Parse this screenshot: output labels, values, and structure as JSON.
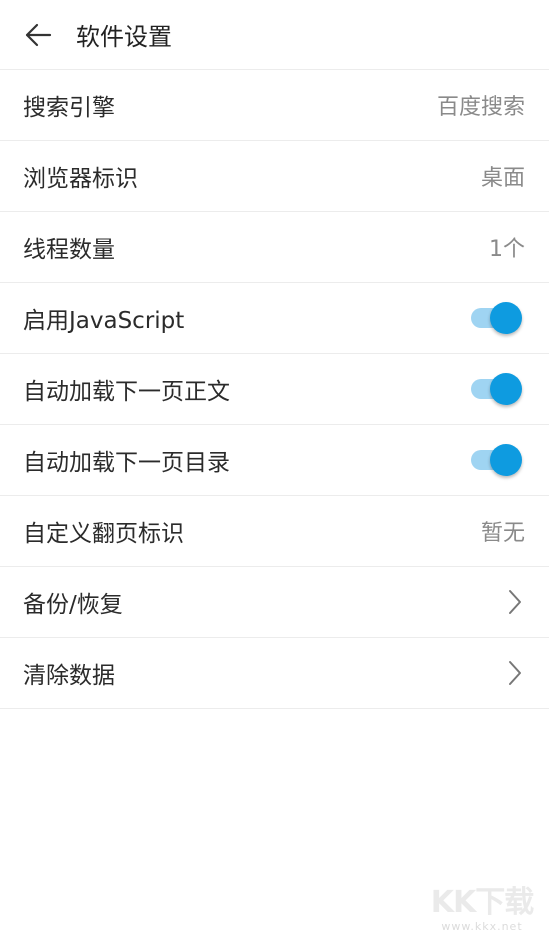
{
  "header": {
    "title": "软件设置"
  },
  "settings": [
    {
      "label": "搜索引擎",
      "value": "百度搜索"
    },
    {
      "label": "浏览器标识",
      "value": "桌面"
    },
    {
      "label": "线程数量",
      "value": "1个"
    },
    {
      "label": "启用JavaScript",
      "toggle": true
    },
    {
      "label": "自动加载下一页正文",
      "toggle": true
    },
    {
      "label": "自动加载下一页目录",
      "toggle": true
    },
    {
      "label": "自定义翻页标识",
      "value": "暂无"
    },
    {
      "label": "备份/恢复",
      "icon": "chevron-right-icon"
    },
    {
      "label": "清除数据",
      "icon": "chevron-right-icon"
    }
  ],
  "watermark": {
    "logo": "KK下载",
    "url": "www.kkx.net"
  },
  "colors": {
    "accent": "#0e9be0",
    "track": "#9fd4f2",
    "divider": "#ececec"
  }
}
